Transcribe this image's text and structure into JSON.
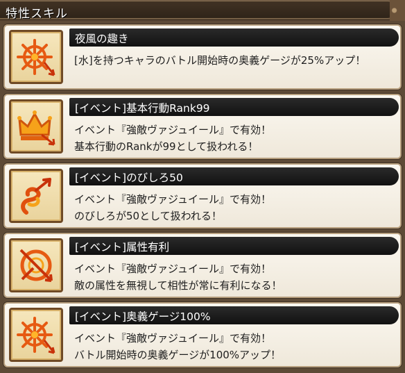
{
  "header": {
    "title": "特性スキル"
  },
  "skills": [
    {
      "icon": "compass-arrow-icon",
      "title": "夜風の趣き",
      "lines": [
        "[水]を持つキャラのバトル開始時の奥義ゲージが25%アップ！",
        ""
      ]
    },
    {
      "icon": "crown-arrow-icon",
      "title": "[イベント]基本行動Rank99",
      "lines": [
        "イベント『強敵ヴァジュイール』で有効！",
        "基本行動のRankが99として扱われる！"
      ]
    },
    {
      "icon": "spiral-arrow-icon",
      "title": "[イベント]のびしろ50",
      "lines": [
        "イベント『強敵ヴァジュイール』で有効！",
        "のびしろが50として扱われる！"
      ]
    },
    {
      "icon": "crossed-arrow-icon",
      "title": "[イベント]属性有利",
      "lines": [
        "イベント『強敵ヴァジュイール』で有効！",
        "敵の属性を無視して相性が常に有利になる！"
      ]
    },
    {
      "icon": "compass-arrow-icon",
      "title": "[イベント]奥義ゲージ100%",
      "lines": [
        "イベント『強敵ヴァジュイール』で有効！",
        "バトル開始時の奥義ゲージが100%アップ！"
      ]
    }
  ]
}
